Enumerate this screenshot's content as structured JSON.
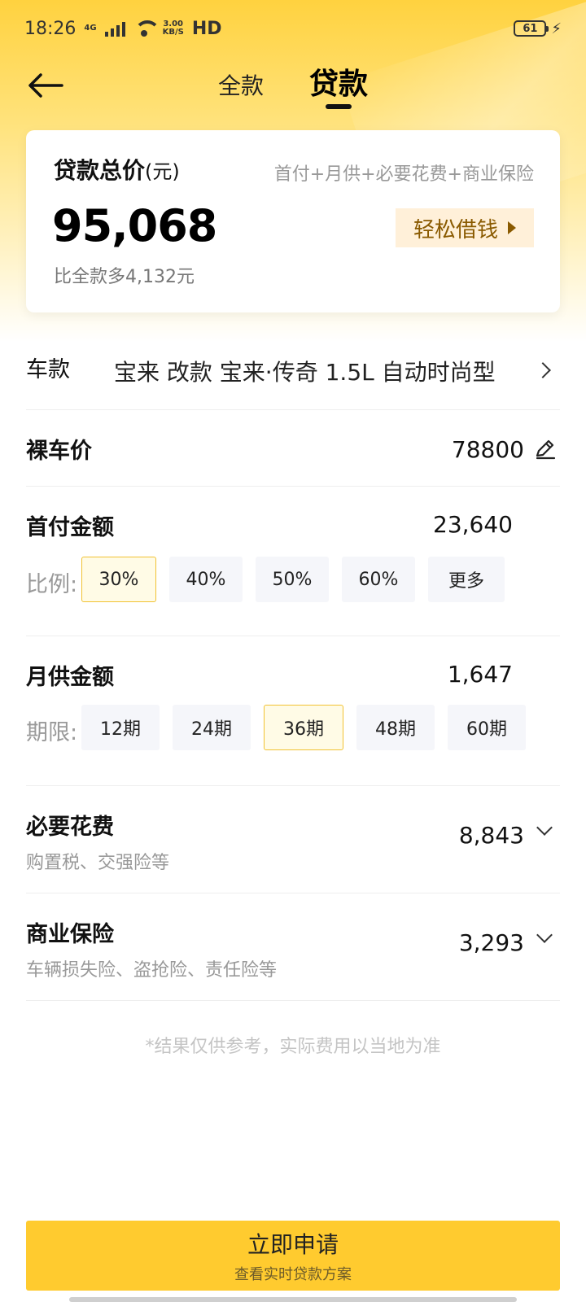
{
  "status_bar": {
    "time": "18:26",
    "network": "4G",
    "speed_value": "3.00",
    "speed_unit": "KB/S",
    "hd": "HD",
    "battery": "61",
    "bolt": "⚡"
  },
  "nav": {
    "tabs": [
      {
        "label": "全款",
        "active": false
      },
      {
        "label": "贷款",
        "active": true
      }
    ]
  },
  "summary": {
    "title": "贷款总价",
    "unit": "(元)",
    "formula": "首付+月供+必要花费+商业保险",
    "amount": "95,068",
    "diff": "比全款多4,132元",
    "borrow_label": "轻松借钱"
  },
  "car": {
    "label": "车款",
    "model": "宝来 改款 宝来·传奇 1.5L 自动时尚型"
  },
  "price": {
    "label": "裸车价",
    "value": "78800"
  },
  "down_payment": {
    "label": "首付金额",
    "value": "23,640",
    "ratio_label": "比例:",
    "options": [
      {
        "label": "30%",
        "active": true
      },
      {
        "label": "40%",
        "active": false
      },
      {
        "label": "50%",
        "active": false
      },
      {
        "label": "60%",
        "active": false
      },
      {
        "label": "更多",
        "active": false
      }
    ]
  },
  "monthly": {
    "label": "月供金额",
    "value": "1,647",
    "term_label": "期限:",
    "options": [
      {
        "label": "12期",
        "active": false
      },
      {
        "label": "24期",
        "active": false
      },
      {
        "label": "36期",
        "active": true
      },
      {
        "label": "48期",
        "active": false
      },
      {
        "label": "60期",
        "active": false
      }
    ]
  },
  "fees": {
    "label": "必要花费",
    "sub": "购置税、交强险等",
    "value": "8,843"
  },
  "insurance": {
    "label": "商业保险",
    "sub": "车辆损失险、盗抢险、责任险等",
    "value": "3,293"
  },
  "disclaimer": "*结果仅供参考，实际费用以当地为准",
  "cta": {
    "main": "立即申请",
    "sub": "查看实时贷款方案"
  },
  "colors": {
    "accent": "#ffcb2f",
    "active_chip_border": "#f1c232",
    "borrow_text": "#8a5a00"
  }
}
